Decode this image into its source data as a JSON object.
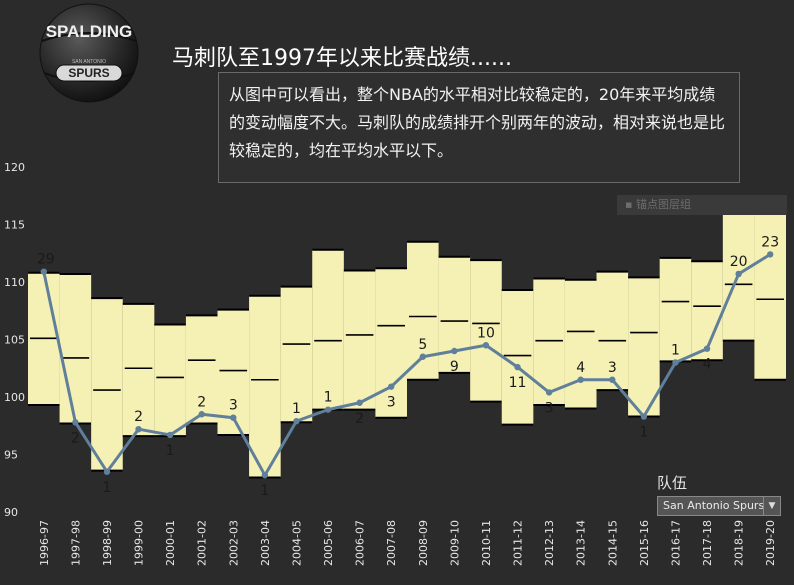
{
  "title": "马刺队至1997年以来比赛战绩......",
  "note": "从图中可以看出，整个NBA的水平相对比较稳定的，20年来平均成绩的变动幅度不大。马刺队的成绩排开个别两年的波动，相对来说也是比较稳定的，均在平均水平以下。",
  "ghost_tag": "▪  锚点图层组",
  "logo": {
    "brand": "SPALDING",
    "team": "SPURS",
    "team_small": "SAN ANTONIO"
  },
  "filter": {
    "label": "队伍",
    "selected": "San Antonio Spurs",
    "caret_icon": "dropdown-caret-icon"
  },
  "colors": {
    "background": "#2b2b2b",
    "band": "#f5f1b4",
    "line": "#5f7f9b",
    "band_edge": "#000000",
    "axis_text": "#e6e6e6",
    "rank_label": "#1a1a1a"
  },
  "chart_data": {
    "type": "line",
    "title": "马刺队至1997年以来比赛战绩......",
    "ylim": [
      90,
      120
    ],
    "yticks": [
      90,
      95,
      100,
      105,
      110,
      115,
      120
    ],
    "categories": [
      "1996-97",
      "1997-98",
      "1998-99",
      "1999-00",
      "2000-01",
      "2001-02",
      "2002-03",
      "2003-04",
      "2004-05",
      "2005-06",
      "2006-07",
      "2007-08",
      "2008-09",
      "2009-10",
      "2010-11",
      "2011-12",
      "2012-13",
      "2013-14",
      "2014-15",
      "2015-16",
      "2016-17",
      "2017-18",
      "2018-19",
      "2019-20"
    ],
    "band_high": [
      110.8,
      110.7,
      108.6,
      108.1,
      106.3,
      107.1,
      107.6,
      108.8,
      109.6,
      112.8,
      111.0,
      111.2,
      113.5,
      112.2,
      111.9,
      109.3,
      110.3,
      110.2,
      110.9,
      110.4,
      112.1,
      111.8,
      116.9,
      116.5
    ],
    "band_low": [
      99.3,
      97.7,
      93.6,
      96.6,
      96.6,
      97.7,
      96.7,
      93.0,
      97.8,
      98.9,
      98.9,
      98.2,
      101.5,
      102.1,
      99.6,
      97.6,
      99.3,
      99.0,
      100.6,
      98.3,
      103.1,
      103.2,
      104.9,
      101.5
    ],
    "band_mid": [
      105.1,
      103.4,
      100.6,
      102.5,
      101.7,
      103.2,
      102.3,
      101.5,
      104.6,
      104.9,
      105.4,
      106.2,
      107.0,
      106.6,
      106.4,
      103.6,
      104.9,
      105.7,
      104.9,
      105.6,
      108.3,
      107.9,
      109.8,
      108.5
    ],
    "series": [
      {
        "values": [
          110.9,
          97.8,
          93.5,
          97.2,
          96.7,
          98.5,
          98.2,
          93.2,
          97.9,
          98.9,
          99.5,
          100.9,
          103.5,
          104.0,
          104.5,
          102.6,
          100.4,
          101.5,
          101.5,
          98.3,
          103.0,
          104.2,
          110.7,
          112.4
        ]
      }
    ],
    "rank_labels": [
      "29",
      "2",
      "1",
      "2",
      "1",
      "2",
      "3",
      "1",
      "1",
      "1",
      "2",
      "3",
      "5",
      "9",
      "10",
      "11",
      "3",
      "4",
      "3",
      "1",
      "1",
      "4",
      "20",
      "23"
    ],
    "rank_label_side": [
      "above",
      "below",
      "below",
      "above",
      "below",
      "above",
      "above",
      "below",
      "above",
      "above",
      "below",
      "below",
      "above",
      "below",
      "above",
      "below",
      "below",
      "above",
      "above",
      "below",
      "above",
      "below",
      "above",
      "above"
    ]
  }
}
